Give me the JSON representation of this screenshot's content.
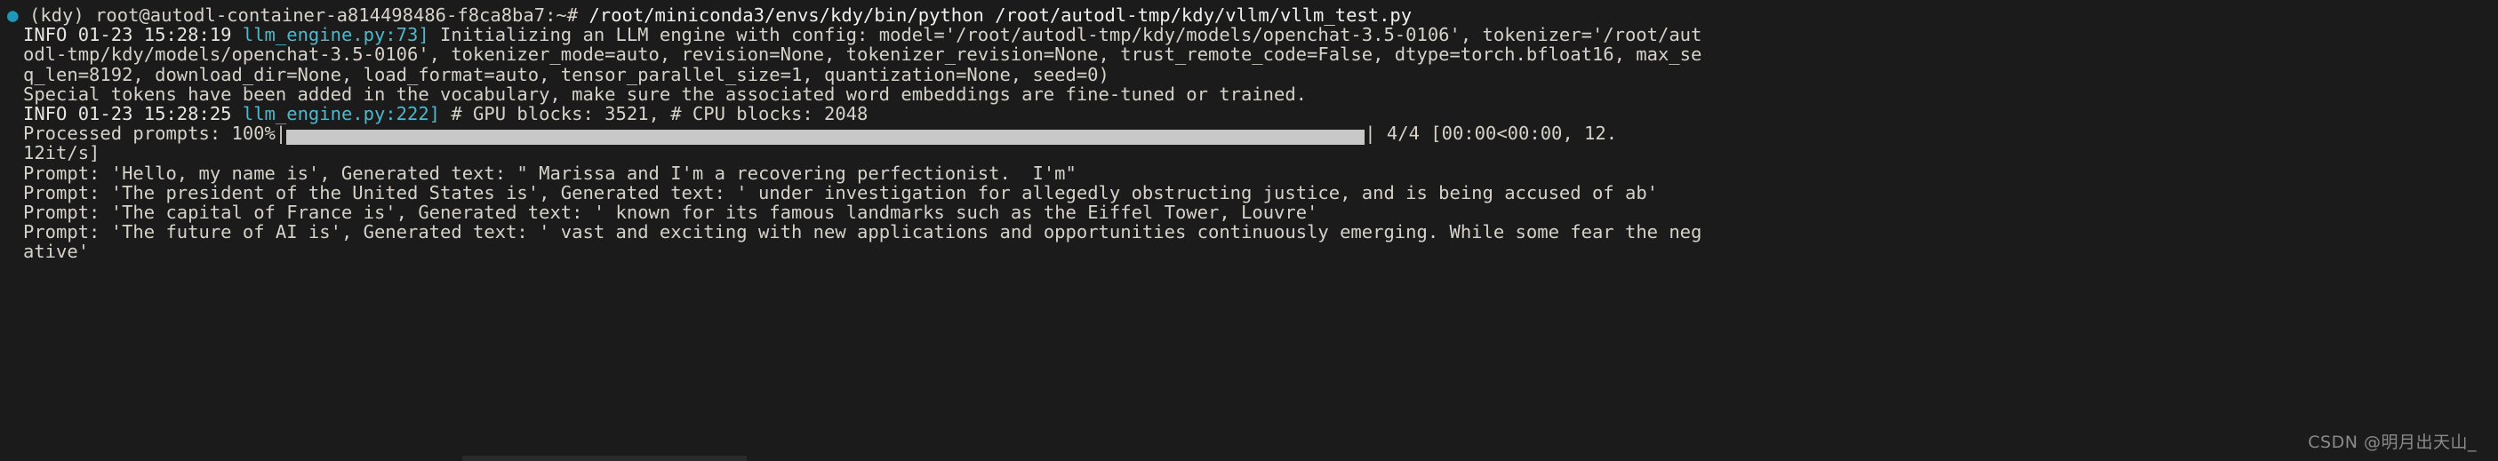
{
  "terminal": {
    "background_color": "#1b1b1b",
    "foreground_color": "#d6d2c9",
    "accent_cyan": "#4fb8cc",
    "accent_blue": "#6aa0d8",
    "prompt_dot_color": "#1f97b8",
    "progress_bar_color": "#c8c8c8",
    "watermark_color": "#8a8a8a"
  },
  "prompt": {
    "dot": "●",
    "env": "(kdy)",
    "user_host": "root@autodl-container-a814498486-f8ca8ba7",
    "path": ":~#",
    "command": " /root/miniconda3/envs/kdy/bin/python /root/autodl-tmp/kdy/vllm/vllm_test.py"
  },
  "log_lines": [
    {
      "id": "info-engine-init",
      "level": "INFO",
      "timestamp": "01-23 15:28:19",
      "source": "llm_engine.py:73]",
      "message": " Initializing an LLM engine with config: model='/root/autodl-tmp/kdy/models/openchat-3.5-0106', tokenizer='/root/aut"
    },
    {
      "id": "info-engine-init-wrap1",
      "text": "odl-tmp/kdy/models/openchat-3.5-0106', tokenizer_mode=auto, revision=None, tokenizer_revision=None, trust_remote_code=False, dtype=torch.bfloat16, max_se"
    },
    {
      "id": "info-engine-init-wrap2",
      "text": "q_len=8192, download_dir=None, load_format=auto, tensor_parallel_size=1, quantization=None, seed=0)"
    },
    {
      "id": "special-tokens-notice",
      "text": "Special tokens have been added in the vocabulary, make sure the associated word embeddings are fine-tuned or trained."
    },
    {
      "id": "info-gpu-blocks",
      "level": "INFO",
      "timestamp": "01-23 15:28:25",
      "source": "llm_engine.py:222]",
      "message": " # GPU blocks: 3521, # CPU blocks: 2048"
    }
  ],
  "progress": {
    "label": "Processed prompts: ",
    "percent": "100%",
    "left_pipe": "|",
    "right_pipe": "|",
    "counter": " 4/4 [00:00<00:00, 12.",
    "wrap": "12it/s]",
    "fill_ratio": 1.0
  },
  "results": [
    {
      "id": "result-1",
      "prefix": "Prompt: ",
      "prompt": "'Hello, my name is'",
      "middle": ", Generated text: ",
      "generated": "\" Marissa and I'm a recovering perfectionist.  I'm\""
    },
    {
      "id": "result-2",
      "prefix": "Prompt: ",
      "prompt": "'The president of the United States is'",
      "middle": ", Generated text: ",
      "generated": "' under investigation for allegedly obstructing justice, and is being accused of ab'"
    },
    {
      "id": "result-3",
      "prefix": "Prompt: ",
      "prompt": "'The capital of France is'",
      "middle": ", Generated text: ",
      "generated": "' known for its famous landmarks such as the Eiffel Tower, Louvre'"
    },
    {
      "id": "result-4",
      "prefix": "Prompt: ",
      "prompt": "'The future of AI is'",
      "middle": ", Generated text: ",
      "generated": "' vast and exciting with new applications and opportunities continuously emerging. While some fear the neg"
    },
    {
      "id": "result-4-wrap",
      "text": "ative'"
    }
  ],
  "watermark": {
    "text": "CSDN @明月出天山_"
  }
}
